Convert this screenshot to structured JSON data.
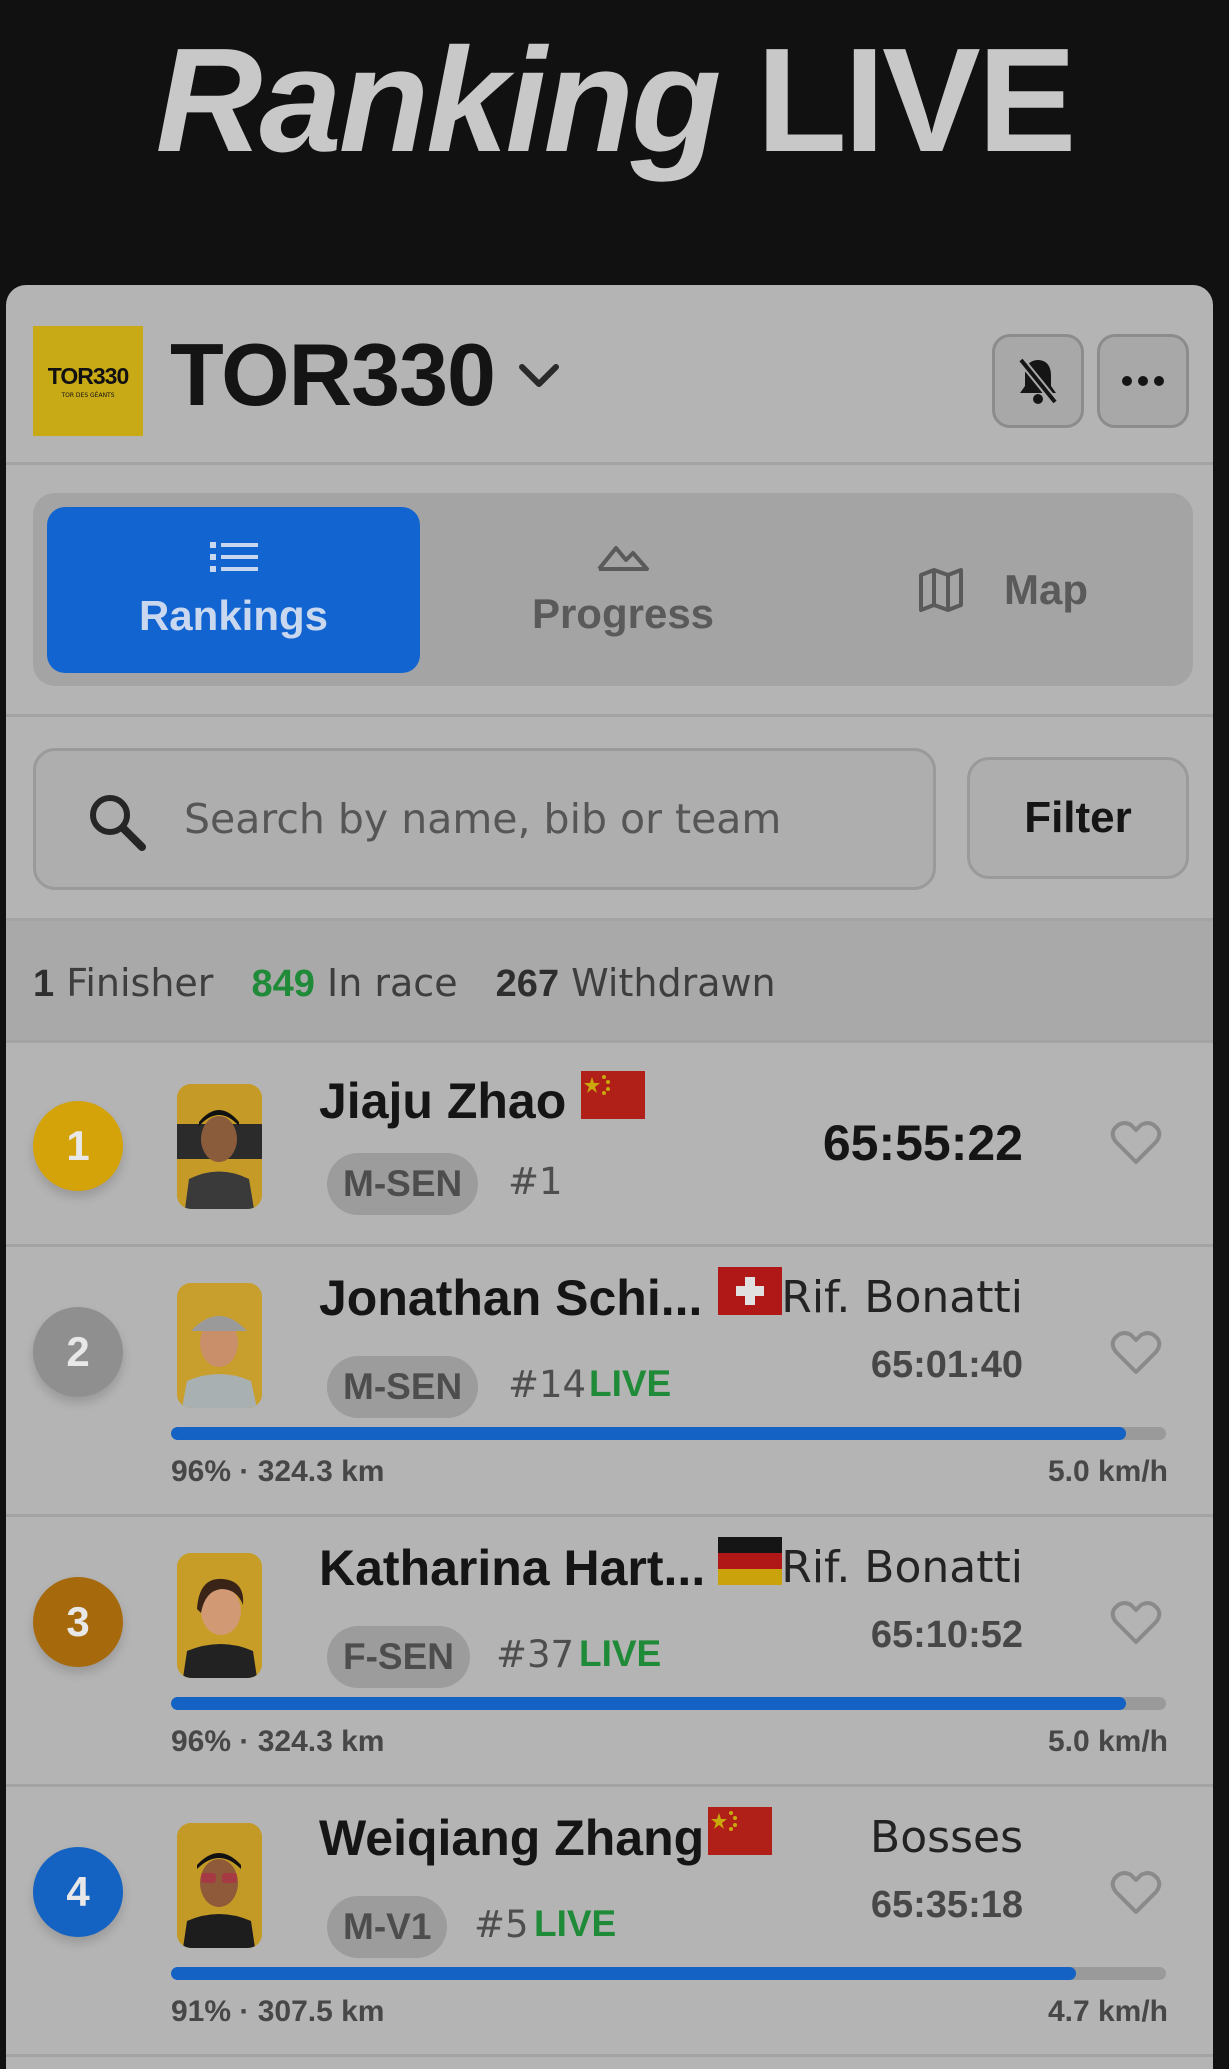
{
  "page": {
    "title_word1": "Ranking",
    "title_word2": "LIVE"
  },
  "header": {
    "logo_text": "TOR330",
    "logo_subtext": "TOR DES GÉANTS",
    "race_name": "TOR330"
  },
  "tabs": [
    {
      "label": "Rankings",
      "icon": "list-icon",
      "active": true
    },
    {
      "label": "Progress",
      "icon": "mountain-icon",
      "active": false
    },
    {
      "label": "Map",
      "icon": "map-icon",
      "active": false
    }
  ],
  "search": {
    "placeholder": "Search by name, bib or team",
    "value": ""
  },
  "filter_label": "Filter",
  "stats": {
    "finishers_count": "1",
    "finishers_label": "Finisher",
    "in_race_count": "849",
    "in_race_label": "In race",
    "withdrawn_count": "267",
    "withdrawn_label": "Withdrawn"
  },
  "colors": {
    "accent": "#1265d0",
    "live": "#1f8a38",
    "gold": "#d4a309",
    "silver": "#8f8f8f",
    "bronze": "#a6690c"
  },
  "runners": [
    {
      "rank": "1",
      "name": "Jiaju Zhao",
      "flag": "china-flag-icon",
      "category": "M-SEN",
      "bib": "#1",
      "live": "",
      "location": "",
      "time": "65:55:22",
      "finished": true
    },
    {
      "rank": "2",
      "name": "Jonathan Schi...",
      "flag": "switzerland-flag-icon",
      "category": "M-SEN",
      "bib": "#14",
      "live": "LIVE",
      "location": "Rif. Bonatti",
      "time": "65:01:40",
      "progress": 0.96,
      "progress_text": "96% · 324.3 km",
      "speed": "5.0 km/h"
    },
    {
      "rank": "3",
      "name": "Katharina Hart...",
      "flag": "germany-flag-icon",
      "category": "F-SEN",
      "bib": "#37",
      "live": "LIVE",
      "location": "Rif. Bonatti",
      "time": "65:10:52",
      "progress": 0.96,
      "progress_text": "96% · 324.3 km",
      "speed": "5.0 km/h"
    },
    {
      "rank": "4",
      "name": "Weiqiang Zhang",
      "flag": "china-flag-icon",
      "category": "M-V1",
      "bib": "#5",
      "live": "LIVE",
      "location": "Bosses",
      "time": "65:35:18",
      "progress": 0.91,
      "progress_text": "91% · 307.5 km",
      "speed": "4.7 km/h"
    }
  ]
}
